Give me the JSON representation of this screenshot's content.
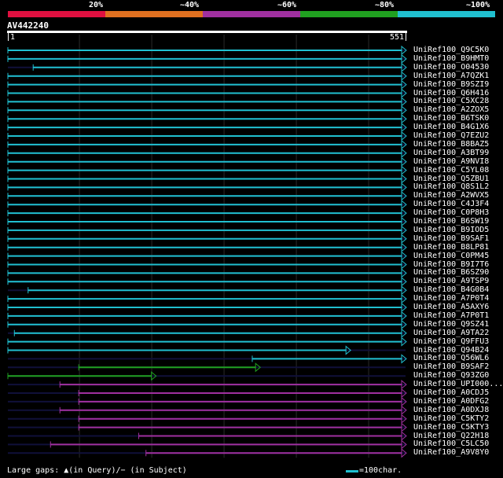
{
  "legend": {
    "labels": [
      "20%",
      "~40%",
      "~60%",
      "~80%",
      "~100%"
    ],
    "colors": [
      "#e01040",
      "#e07020",
      "#a030a0",
      "#20a020",
      "#20c0d0"
    ]
  },
  "query": {
    "name": "AV442240",
    "start": "1",
    "end": "551",
    "length": 551
  },
  "hits": [
    {
      "name": "UniRef100_Q9C5K0",
      "color": "cyan",
      "start": 1,
      "end": 551,
      "arrow": true
    },
    {
      "name": "UniRef100_B9HMT0",
      "color": "cyan",
      "start": 1,
      "end": 551,
      "arrow": true
    },
    {
      "name": "UniRef100_O04530",
      "color": "cyan",
      "start": 36,
      "end": 551,
      "arrow": true
    },
    {
      "name": "UniRef100_A7QZK1",
      "color": "cyan",
      "start": 1,
      "end": 551,
      "arrow": true
    },
    {
      "name": "UniRef100_B9SZI9",
      "color": "cyan",
      "start": 1,
      "end": 551,
      "arrow": true
    },
    {
      "name": "UniRef100_Q6H416",
      "color": "cyan",
      "start": 1,
      "end": 551,
      "arrow": true
    },
    {
      "name": "UniRef100_C5XC28",
      "color": "cyan",
      "start": 1,
      "end": 551,
      "arrow": true
    },
    {
      "name": "UniRef100_A2ZOX5",
      "color": "cyan",
      "start": 1,
      "end": 551,
      "arrow": true
    },
    {
      "name": "UniRef100_B6TSK0",
      "color": "cyan",
      "start": 1,
      "end": 551,
      "arrow": true
    },
    {
      "name": "UniRef100_B4G1X6",
      "color": "cyan",
      "start": 1,
      "end": 551,
      "arrow": true
    },
    {
      "name": "UniRef100_Q7EZU2",
      "color": "cyan",
      "start": 1,
      "end": 551,
      "arrow": true
    },
    {
      "name": "UniRef100_B8BAZ5",
      "color": "cyan",
      "start": 1,
      "end": 551,
      "arrow": true
    },
    {
      "name": "UniRef100_A3BT99",
      "color": "cyan",
      "start": 1,
      "end": 551,
      "arrow": true
    },
    {
      "name": "UniRef100_A9NVI8",
      "color": "cyan",
      "start": 1,
      "end": 551,
      "arrow": true
    },
    {
      "name": "UniRef100_C5YL08",
      "color": "cyan",
      "start": 1,
      "end": 551,
      "arrow": true
    },
    {
      "name": "UniRef100_Q5ZBU1",
      "color": "cyan",
      "start": 1,
      "end": 551,
      "arrow": true
    },
    {
      "name": "UniRef100_Q8S1L2",
      "color": "cyan",
      "start": 1,
      "end": 551,
      "arrow": true
    },
    {
      "name": "UniRef100_A2WVX5",
      "color": "cyan",
      "start": 1,
      "end": 551,
      "arrow": true
    },
    {
      "name": "UniRef100_C4J3F4",
      "color": "cyan",
      "start": 1,
      "end": 551,
      "arrow": true
    },
    {
      "name": "UniRef100_C0P8H3",
      "color": "cyan",
      "start": 1,
      "end": 551,
      "arrow": true
    },
    {
      "name": "UniRef100_B6SW19",
      "color": "cyan",
      "start": 1,
      "end": 551,
      "arrow": true
    },
    {
      "name": "UniRef100_B9IOD5",
      "color": "cyan",
      "start": 1,
      "end": 551,
      "arrow": true
    },
    {
      "name": "UniRef100_B9SAF1",
      "color": "cyan",
      "start": 1,
      "end": 551,
      "arrow": true
    },
    {
      "name": "UniRef100_B8LP81",
      "color": "cyan",
      "start": 1,
      "end": 551,
      "arrow": true
    },
    {
      "name": "UniRef100_C0PM45",
      "color": "cyan",
      "start": 1,
      "end": 551,
      "arrow": true
    },
    {
      "name": "UniRef100_B9I7T6",
      "color": "cyan",
      "start": 1,
      "end": 551,
      "arrow": true
    },
    {
      "name": "UniRef100_B6SZ90",
      "color": "cyan",
      "start": 1,
      "end": 551,
      "arrow": true
    },
    {
      "name": "UniRef100_A9TSP9",
      "color": "cyan",
      "start": 1,
      "end": 551,
      "arrow": true
    },
    {
      "name": "UniRef100_B4G0B4",
      "color": "cyan",
      "start": 29,
      "end": 551,
      "arrow": true
    },
    {
      "name": "UniRef100_A7P0T4",
      "color": "cyan",
      "start": 1,
      "end": 551,
      "arrow": true
    },
    {
      "name": "UniRef100_A5AXY6",
      "color": "cyan",
      "start": 1,
      "end": 551,
      "arrow": true
    },
    {
      "name": "UniRef100_A7P0T1",
      "color": "cyan",
      "start": 1,
      "end": 551,
      "arrow": true
    },
    {
      "name": "UniRef100_Q9SZ41",
      "color": "cyan",
      "start": 1,
      "end": 551,
      "arrow": true
    },
    {
      "name": "UniRef100_A9TA22",
      "color": "cyan",
      "start": 10,
      "end": 551,
      "arrow": true
    },
    {
      "name": "UniRef100_Q9FFU3",
      "color": "cyan",
      "start": 1,
      "end": 551,
      "arrow": true
    },
    {
      "name": "UniRef100_Q94B24",
      "color": "cyan",
      "start": 1,
      "end": 474,
      "arrow": true
    },
    {
      "name": "UniRef100_Q56WL6",
      "color": "cyan",
      "start": 339,
      "end": 551,
      "arrow": true
    },
    {
      "name": "UniRef100_B9SAF2",
      "color": "green",
      "start": 99,
      "end": 349,
      "arrow": true
    },
    {
      "name": "UniRef100_Q93ZG0",
      "color": "green",
      "start": 1,
      "end": 205,
      "arrow": true
    },
    {
      "name": "UniRef100_UPI000...",
      "color": "purple",
      "start": 73,
      "end": 551,
      "arrow": true
    },
    {
      "name": "UniRef100_A0CDJ5",
      "color": "purple",
      "start": 99,
      "end": 551,
      "arrow": true
    },
    {
      "name": "UniRef100_A0DFG2",
      "color": "purple",
      "start": 99,
      "end": 551,
      "arrow": true
    },
    {
      "name": "UniRef100_A0DXJ8",
      "color": "purple",
      "start": 73,
      "end": 551,
      "arrow": true
    },
    {
      "name": "UniRef100_C5KTY2",
      "color": "purple",
      "start": 99,
      "end": 551,
      "arrow": true
    },
    {
      "name": "UniRef100_C5KTY3",
      "color": "purple",
      "start": 99,
      "end": 551,
      "arrow": true
    },
    {
      "name": "UniRef100_Q22H18",
      "color": "purple",
      "start": 182,
      "end": 551,
      "arrow": true
    },
    {
      "name": "UniRef100_C5LC50",
      "color": "purple",
      "start": 60,
      "end": 551,
      "arrow": true
    },
    {
      "name": "UniRef100_A9V8Y0",
      "color": "purple",
      "start": 192,
      "end": 551,
      "arrow": true
    }
  ],
  "hit_colors": {
    "cyan": "#20c0d0",
    "green": "#20a020",
    "purple": "#a030a0"
  },
  "footer": {
    "left": "Large gaps: ▲(in Query)/− (in Subject)",
    "right": "=100char."
  }
}
